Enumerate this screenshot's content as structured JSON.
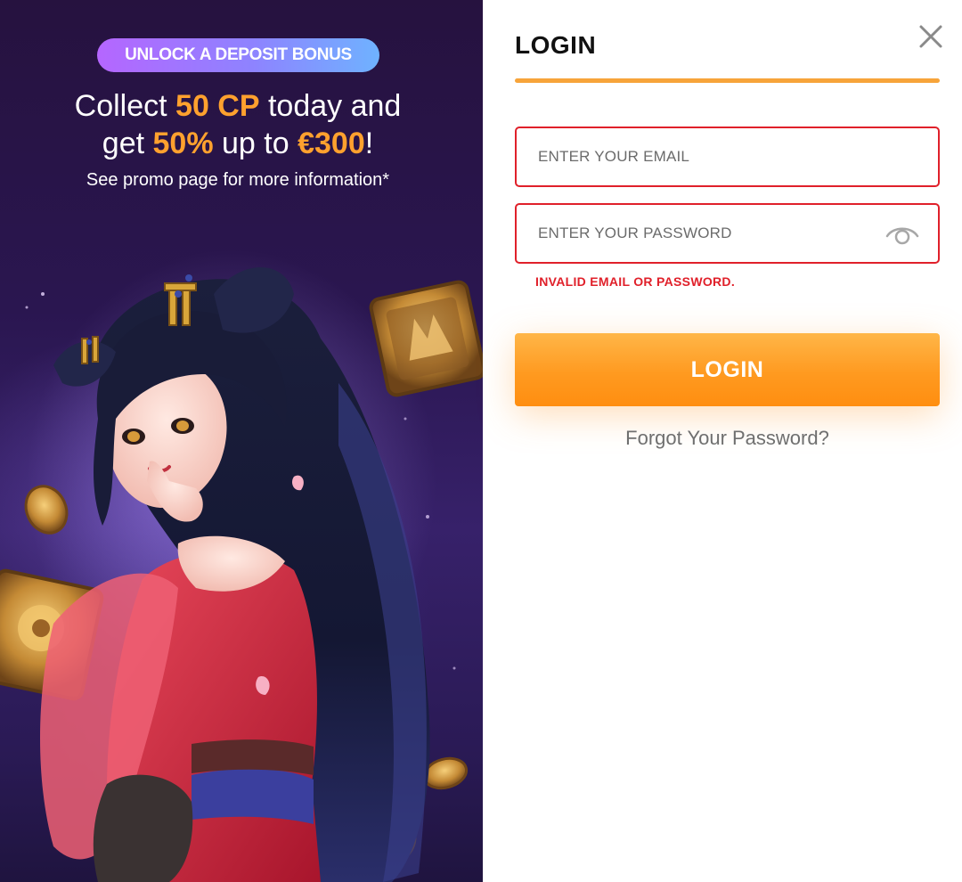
{
  "promo": {
    "badge": "UNLOCK A DEPOSIT BONUS",
    "headline": {
      "part1": "Collect ",
      "cp": "50 CP",
      "part2": " today and",
      "part3": "get ",
      "percent": "50%",
      "part4": " up to ",
      "amount": "€300",
      "part5": "!"
    },
    "subline": "See promo page for more information*",
    "accent_color": "#ffa12e"
  },
  "login": {
    "title": "LOGIN",
    "close_icon": "close-icon",
    "email_placeholder": "ENTER YOUR EMAIL",
    "email_value": "",
    "password_placeholder": "ENTER YOUR PASSWORD",
    "password_value": "",
    "show_password_icon": "eye-icon",
    "error_message": "INVALID EMAIL OR PASSWORD.",
    "submit_label": "LOGIN",
    "forgot_label": "Forgot Your Password?",
    "error_color": "#e0202a",
    "button_color": "#ff9a20"
  }
}
